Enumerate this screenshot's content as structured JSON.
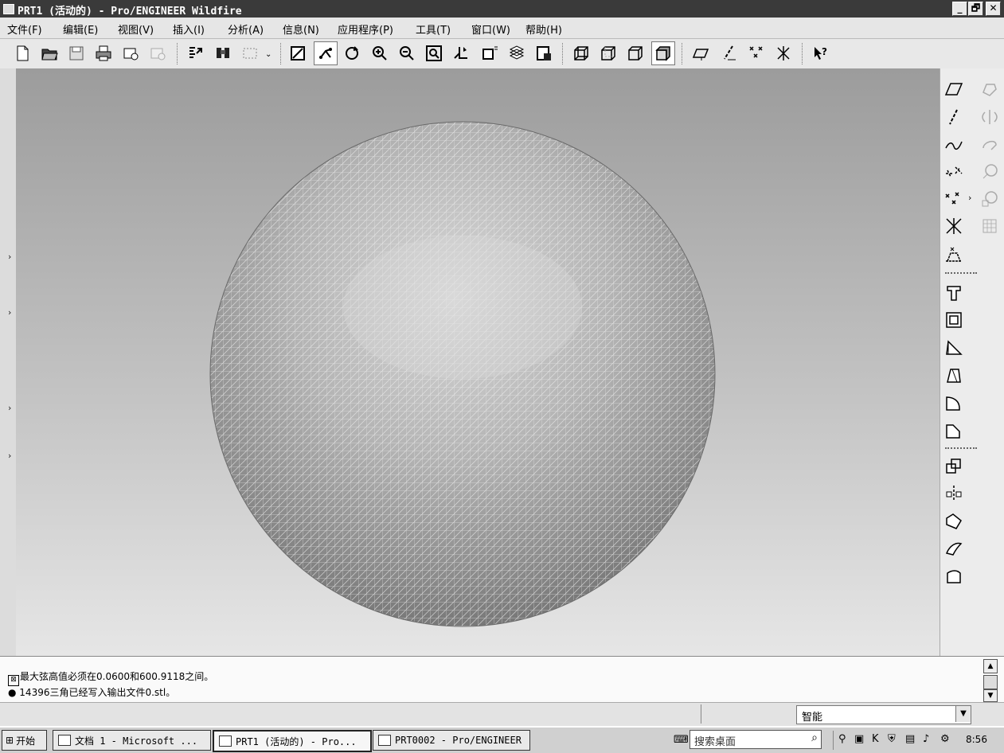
{
  "window": {
    "title": "PRT1 (活动的) - Pro/ENGINEER Wildfire",
    "btn_min": "_",
    "btn_max": "🗗",
    "btn_close": "✕"
  },
  "menu": {
    "items": [
      "文件(F)",
      "编辑(E)",
      "视图(V)",
      "插入(I)",
      "分析(A)",
      "信息(N)",
      "应用程序(P)",
      "工具(T)",
      "窗口(W)",
      "帮助(H)"
    ]
  },
  "toolbar": {
    "icons": [
      "new-file",
      "open-folder",
      "save",
      "print",
      "send-mail",
      "mail-disabled",
      "regenerate",
      "find",
      "select-box",
      "repaint",
      "spin-center",
      "orient",
      "zoom-in",
      "zoom-out",
      "refit",
      "reorient",
      "saved-views",
      "layers",
      "view-manager",
      "wireframe",
      "hidden-line",
      "no-hidden",
      "shading",
      "datum-planes",
      "datum-axes",
      "datum-points",
      "csys",
      "whats-this"
    ]
  },
  "right_toolbar": {
    "icons": [
      "datum-plane",
      "datum-axis",
      "datum-curve",
      "sketched-datum",
      "datum-point",
      "csys",
      "analysis-feature",
      "hole",
      "shell",
      "rib",
      "draft",
      "round",
      "chamfer",
      "copy",
      "mirror",
      "merge",
      "trim",
      "offset",
      "pattern",
      "extrude-disabled",
      "revolve-disabled",
      "variable-sweep-disabled",
      "blend-disabled",
      "boundary-disabled",
      "style-disabled"
    ]
  },
  "messages": [
    {
      "icon": "prompt-icon",
      "text": "最大弦高值必须在0.0600和600.9118之间。"
    },
    {
      "icon": "bullet",
      "text": "14396三角已经写入输出文件0.stl。"
    }
  ],
  "status": {
    "filter_value": "智能"
  },
  "taskbar": {
    "start": "开始",
    "tasks": [
      {
        "label": "文档 1 - Microsoft ...",
        "active": false
      },
      {
        "label": "PRT1 (活动的) - Pro...",
        "active": true
      },
      {
        "label": "PRT0002 - Pro/ENGINEER",
        "active": false
      }
    ],
    "search_placeholder": "搜索桌面",
    "clock": "8:56"
  },
  "colors": {
    "title_bg": "#3a3a3a",
    "viewport_top": "#9c9c9c",
    "viewport_bottom": "#e6e6e6"
  }
}
